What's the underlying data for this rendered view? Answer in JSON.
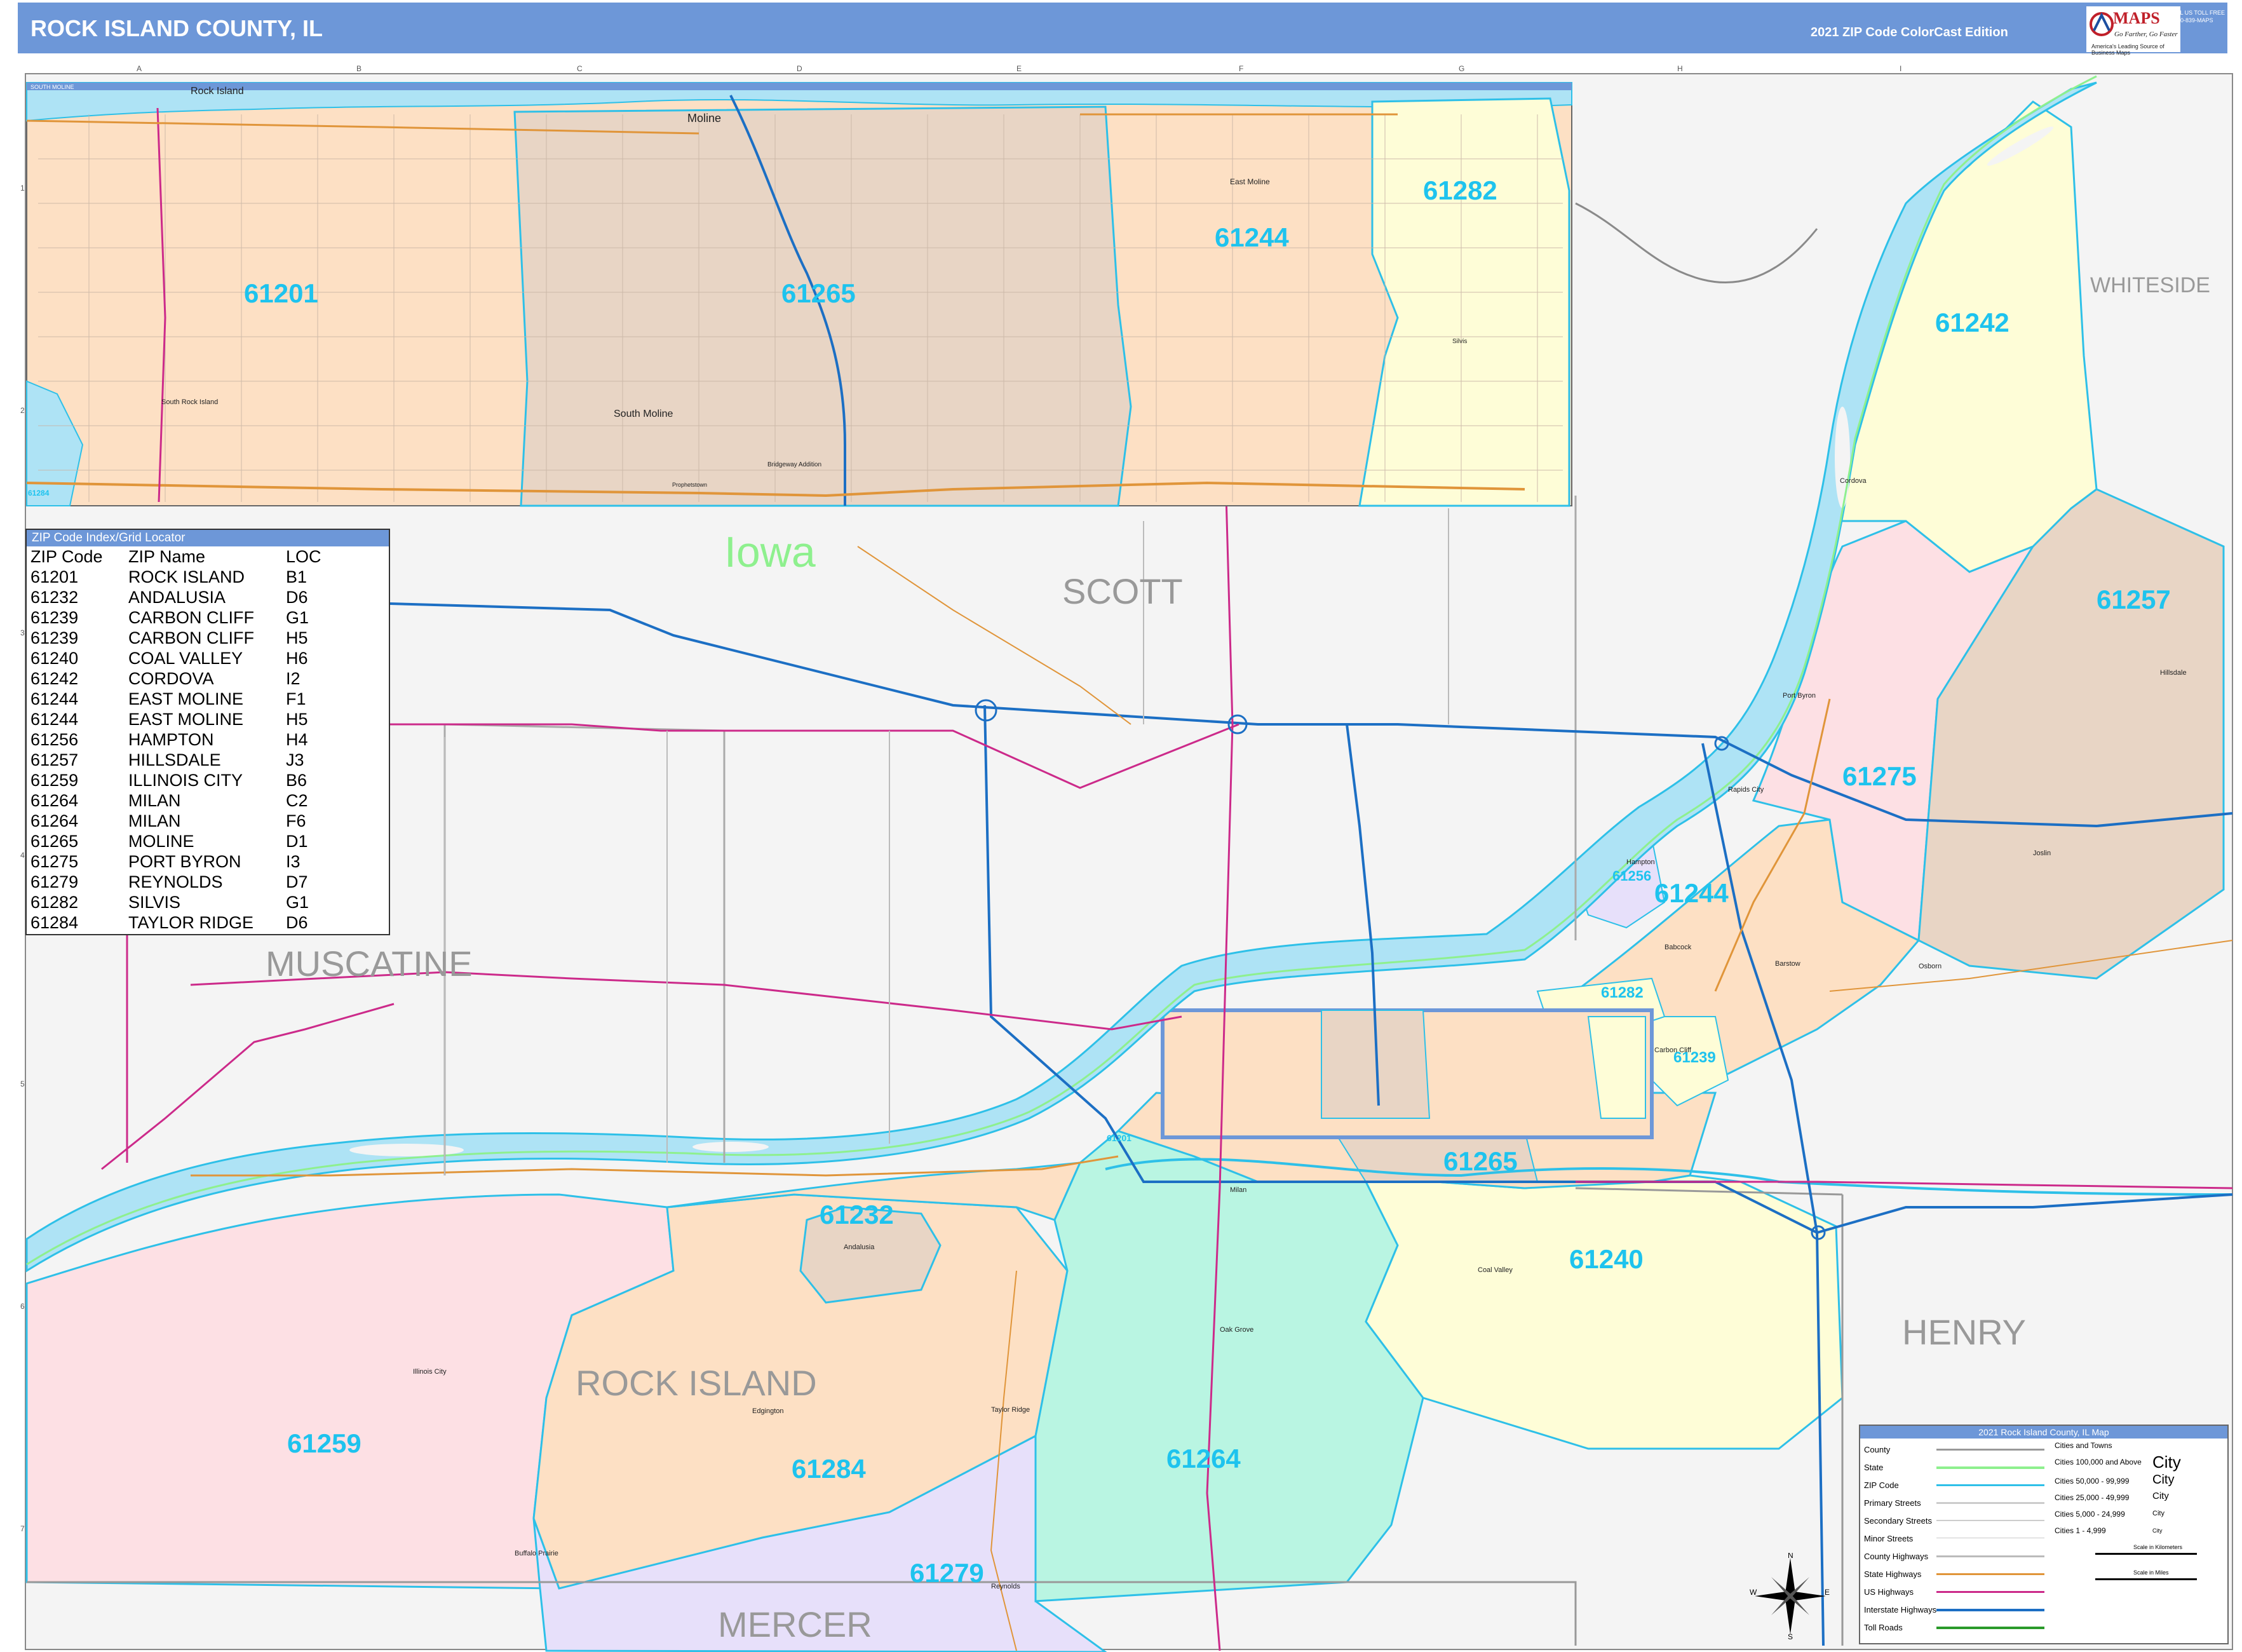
{
  "header": {
    "title": "ROCK ISLAND COUNTY, IL",
    "edition": "2021 ZIP Code ColorCast Edition",
    "logo": {
      "brand": "MAPS",
      "tagline": "Go Farther, Go Faster",
      "sub": "America's Leading Source of Business Maps",
      "phone": "CALL US TOLL FREE 1-800-839-MAPS"
    }
  },
  "grid": {
    "columns": [
      "A",
      "B",
      "C",
      "D",
      "E",
      "F",
      "G",
      "H",
      "I"
    ],
    "rows": [
      "1",
      "2",
      "3",
      "4",
      "5",
      "6",
      "7"
    ]
  },
  "labels": {
    "iowa": "Iowa",
    "scott": "SCOTT",
    "muscatine": "MUSCATINE",
    "whiteside": "WHITESIDE",
    "henry": "HENRY",
    "mercer": "MERCER",
    "rock_island": "ROCK ISLAND"
  },
  "inset": {
    "title_strip": "SOUTH MOLINE",
    "towns": {
      "rock_island": "Rock Island",
      "moline": "Moline",
      "east_moline": "East Moline",
      "south_rock_island": "South Rock Island",
      "south_moline": "South Moline",
      "bridgeway": "Bridgeway Addition",
      "prophetstown": "Prophetstown",
      "silvis": "Silvis"
    },
    "zips": {
      "z61201": "61201",
      "z61265": "61265",
      "z61244": "61244",
      "z61282": "61282",
      "z61284": "61284"
    }
  },
  "zips": {
    "z61242": "61242",
    "z61257": "61257",
    "z61275": "61275",
    "z61256": "61256",
    "z61244": "61244",
    "z61282": "61282",
    "z61239": "61239",
    "z61201": "61201",
    "z61265": "61265",
    "z61232": "61232",
    "z61240": "61240",
    "z61259": "61259",
    "z61284": "61284",
    "z61264": "61264",
    "z61279": "61279"
  },
  "towns": {
    "cordova": "Cordova",
    "port_byron": "Port Byron",
    "hillsdale": "Hillsdale",
    "joslin": "Joslin",
    "rapids_city": "Rapids City",
    "hampton": "Hampton",
    "barstow": "Barstow",
    "osborn": "Osborn",
    "carbon_cliff": "Carbon Cliff",
    "milan": "Milan",
    "coal_valley": "Coal Valley",
    "oak_grove": "Oak Grove",
    "edgington": "Edgington",
    "taylor_ridge": "Taylor Ridge",
    "illinois_city": "Illinois City",
    "buffalo_prairie": "Buffalo Prairie",
    "reynolds": "Reynolds",
    "andalusia": "Andalusia",
    "babcock": "Babcock"
  },
  "zip_index": {
    "title": "ZIP Code Index/Grid Locator",
    "headers": [
      "ZIP Code",
      "ZIP Name",
      "LOC"
    ],
    "rows": [
      [
        "61201",
        "ROCK ISLAND",
        "B1"
      ],
      [
        "61232",
        "ANDALUSIA",
        "D6"
      ],
      [
        "61239",
        "CARBON CLIFF",
        "G1"
      ],
      [
        "61239",
        "CARBON CLIFF",
        "H5"
      ],
      [
        "61240",
        "COAL VALLEY",
        "H6"
      ],
      [
        "61242",
        "CORDOVA",
        "I2"
      ],
      [
        "61244",
        "EAST MOLINE",
        "F1"
      ],
      [
        "61244",
        "EAST MOLINE",
        "H5"
      ],
      [
        "61256",
        "HAMPTON",
        "H4"
      ],
      [
        "61257",
        "HILLSDALE",
        "J3"
      ],
      [
        "61259",
        "ILLINOIS CITY",
        "B6"
      ],
      [
        "61264",
        "MILAN",
        "C2"
      ],
      [
        "61264",
        "MILAN",
        "F6"
      ],
      [
        "61265",
        "MOLINE",
        "D1"
      ],
      [
        "61275",
        "PORT BYRON",
        "I3"
      ],
      [
        "61279",
        "REYNOLDS",
        "D7"
      ],
      [
        "61282",
        "SILVIS",
        "G1"
      ],
      [
        "61284",
        "TAYLOR RIDGE",
        "D6"
      ]
    ]
  },
  "legend": {
    "title": "2021 Rock Island County, IL Map",
    "items": [
      "County",
      "State",
      "ZIP Code",
      "Primary Streets",
      "Secondary Streets",
      "Minor Streets",
      "County Highways",
      "State Highways",
      "US Highways",
      "Interstate Highways",
      "Toll Roads"
    ],
    "cities_title": "Cities and Towns",
    "cities": [
      "Cities 100,000 and Above",
      "Cities 50,000 - 99,999",
      "Cities 25,000 - 49,999",
      "Cities 5,000 - 24,999",
      "Cities 1 - 4,999"
    ],
    "city_sample": "City",
    "scale_km": "Scale in Kilometers",
    "scale_mi": "Scale in Miles"
  },
  "compass": {
    "n": "N",
    "s": "S",
    "e": "E",
    "w": "W"
  },
  "colors": {
    "header": "#6d97d8",
    "zip_label": "#1ec3ee",
    "water": "#aee3f5",
    "zip_boundary": "#2ec0e8",
    "peach": "#fde0c4",
    "tan": "#e8d5c5",
    "yellow": "#fefdd7",
    "pink": "#fde0e4",
    "green": "#b9f5e2",
    "lavender": "#e7e0fa",
    "state_line": "#8ef08e",
    "us_highway": "#cc2a8a",
    "interstate": "#1c6fc4",
    "state_highway": "#e0953a"
  }
}
